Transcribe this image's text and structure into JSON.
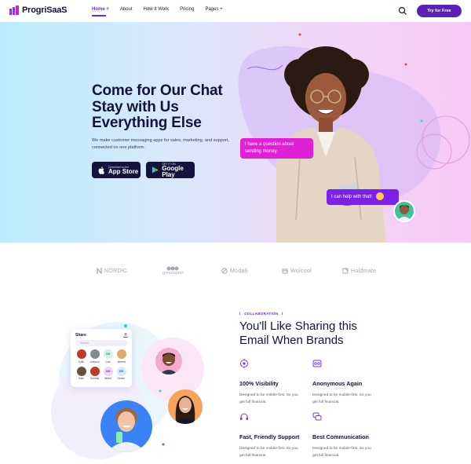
{
  "nav": {
    "brand": "ProgriSaaS",
    "items": [
      {
        "label": "Home +",
        "active": true
      },
      {
        "label": "About",
        "active": false
      },
      {
        "label": "How It Work",
        "active": false
      },
      {
        "label": "Pricing",
        "active": false
      },
      {
        "label": "Pages +",
        "active": false
      }
    ],
    "search_icon": "search-icon",
    "cta_label": "Try for Free",
    "accent": "#5b21b6"
  },
  "hero": {
    "title_lines": [
      "Come for Our Chat",
      "Stay with Us",
      "Everything Else"
    ],
    "subtitle": "We make customer messaging apps for sales, marketing, and support, connected on one platform.",
    "app_store": {
      "small": "Download on the",
      "big": "App Store"
    },
    "google_play": {
      "small": "GET IT ON",
      "big": "Google Play"
    },
    "bubble1": "I have a question about sending money.",
    "bubble2": "I can help with that!",
    "bubble1_color": "#e11fd6",
    "bubble2_color": "#7c22e8"
  },
  "brands": [
    {
      "name": "NORDIC",
      "icon": "nordic-icon"
    },
    {
      "name": "greensport",
      "icon": "greensport-icon"
    },
    {
      "name": "Modali",
      "icon": "modali-icon"
    },
    {
      "name": "Wolcool",
      "icon": "wolcool-icon"
    },
    {
      "name": "Holdmate",
      "icon": "holdmate-icon"
    }
  ],
  "collab": {
    "eyebrow": "COLLABORATION",
    "slash": "/",
    "title_lines": [
      "You'll Like Sharing this",
      "Email When Brands"
    ],
    "features": [
      {
        "title": "100% Visibility",
        "desc": "Designed to be mobile-first. So you get full financial.",
        "icon": "eye-target-icon"
      },
      {
        "title": "Anonymous Again",
        "desc": "Designed to be mobile-first. So you get full financial.",
        "icon": "mask-icon"
      },
      {
        "title": "Fast, Friendly Support",
        "desc": "Designed to be mobile-first. So you get full financial.",
        "icon": "headset-icon"
      },
      {
        "title": "Best Communication",
        "desc": "Designed to be mobile-first. So you get full financial.",
        "icon": "chat-icon"
      }
    ]
  },
  "share": {
    "title": "Share",
    "search_placeholder": "Search",
    "people": [
      {
        "name": "Kylie",
        "initials": "",
        "color": "#c0392b"
      },
      {
        "name": "Johnson",
        "initials": "",
        "color": "#7f8c8d"
      },
      {
        "name": "Curt",
        "initials": "CM",
        "color": "#d4f3e6"
      },
      {
        "name": "Jimena",
        "initials": "",
        "color": "#e0a96d"
      },
      {
        "name": "Kate",
        "initials": "",
        "color": "#6d4c41"
      },
      {
        "name": "Tommie",
        "initials": "",
        "color": "#c0392b"
      },
      {
        "name": "Albert",
        "initials": "AW",
        "color": "#ead7fb"
      },
      {
        "name": "Dexter",
        "initials": "DR",
        "color": "#dbe7fb"
      }
    ]
  }
}
